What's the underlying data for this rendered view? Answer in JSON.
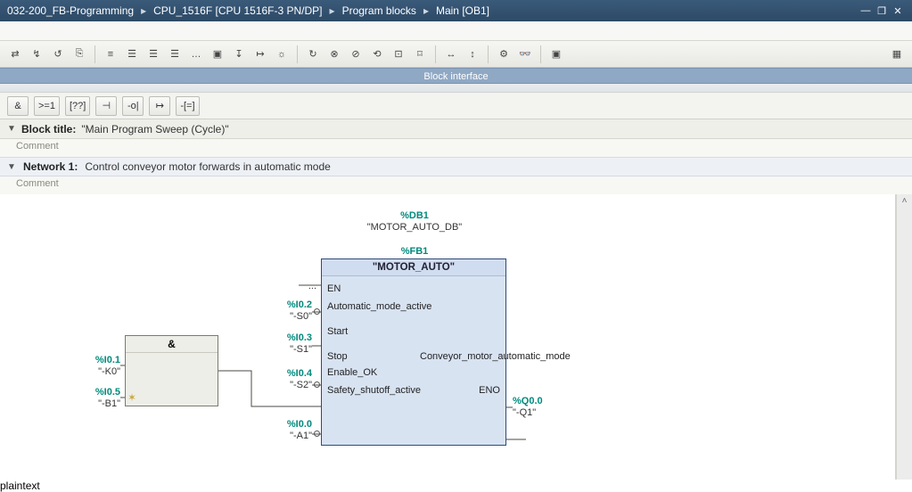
{
  "breadcrumbs": [
    "032-200_FB-Programming",
    "CPU_1516F [CPU 1516F-3 PN/DP]",
    "Program blocks",
    "Main [OB1]"
  ],
  "winbtns": {
    "min": "—",
    "max": "❐",
    "close": "✕"
  },
  "toolbar": {
    "icons": [
      "⇄",
      "↯",
      "↺",
      "⎘",
      "≡",
      "☰",
      "☰",
      "☰",
      "…",
      "▣",
      "↧",
      "↦",
      "☼",
      "↻",
      "⊗",
      "⊘",
      "⟲",
      "⊡",
      "⌑",
      "↔",
      "↕",
      "⚙",
      "👓",
      "▣"
    ]
  },
  "block_interface": "Block interface",
  "favorites": [
    "&",
    ">=1",
    "[??]",
    "⊣",
    "-o|",
    "↦",
    "-[=]"
  ],
  "block": {
    "title_label": "Block title:",
    "title_value": "\"Main Program Sweep (Cycle)\"",
    "comment_label": "Comment"
  },
  "network": {
    "title": "Network 1:",
    "desc": "Control conveyor motor forwards in automatic mode",
    "comment_label": "Comment"
  },
  "fbd": {
    "db": {
      "addr": "%DB1",
      "sym": "\"MOTOR_AUTO_DB\""
    },
    "fb": {
      "addr": "%FB1",
      "name": "\"MOTOR_AUTO\"",
      "inputs": [
        {
          "port": "EN",
          "tag_addr": "...",
          "tag_sym": ""
        },
        {
          "port": "Automatic_mode_active",
          "tag_addr": "%I0.2",
          "tag_sym": "\"-S0\"",
          "neg": true
        },
        {
          "port": "Start",
          "tag_addr": "%I0.3",
          "tag_sym": "\"-S1\""
        },
        {
          "port": "Stop",
          "tag_addr": "%I0.4",
          "tag_sym": "\"-S2\"",
          "neg": true
        },
        {
          "port": "Enable_OK",
          "from_and": true
        },
        {
          "port": "Safety_shutoff_active",
          "tag_addr": "%I0.0",
          "tag_sym": "\"-A1\"",
          "neg": true
        }
      ],
      "outputs": [
        {
          "port": "Conveyor_motor_automatic_mode",
          "tag_addr": "%Q0.0",
          "tag_sym": "\"-Q1\""
        },
        {
          "port": "ENO"
        }
      ]
    },
    "and": {
      "label": "&",
      "inputs": [
        {
          "tag_addr": "%I0.1",
          "tag_sym": "\"-K0\""
        },
        {
          "tag_addr": "%I0.5",
          "tag_sym": "\"-B1\""
        }
      ]
    }
  }
}
